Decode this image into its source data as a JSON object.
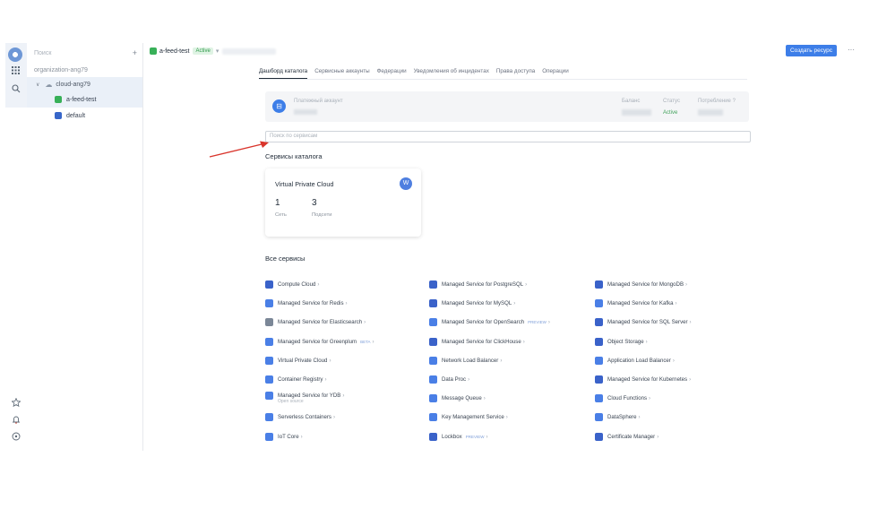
{
  "rail": {
    "icons": [
      "logo-icon",
      "apps-grid-icon",
      "search-icon",
      "star-icon",
      "bell-icon",
      "help-icon"
    ]
  },
  "tree": {
    "search_placeholder": "Поиск",
    "org": "organization-ang79",
    "cloud": "cloud-ang79",
    "folders": [
      {
        "name": "a-feed-test",
        "color": "#38b058"
      },
      {
        "name": "default",
        "color": "#3766c9"
      }
    ]
  },
  "topbar": {
    "folder": "a-feed-test",
    "status": "Active",
    "create_button": "Создать ресурс",
    "more": "···"
  },
  "tabs": [
    "Дашборд каталога",
    "Сервисные аккаунты",
    "Федерации",
    "Уведомления об инцидентах",
    "Права доступа",
    "Операции"
  ],
  "account": {
    "label": "Платежный аккаунт",
    "balance_label": "Баланс",
    "status_label": "Статус",
    "status_value": "Active",
    "consumption_label": "Потребление",
    "consumption_help": "?"
  },
  "service_search": {
    "placeholder": "Поиск по сервисам"
  },
  "catalog_services": {
    "heading": "Сервисы каталога",
    "card": {
      "title": "Virtual Private Cloud",
      "badge": "W",
      "stats": [
        {
          "value": "1",
          "label": "Сеть"
        },
        {
          "value": "3",
          "label": "Подсети"
        }
      ]
    }
  },
  "all_services": {
    "heading": "Все сервисы",
    "columns": [
      [
        {
          "name": "Compute Cloud",
          "icon": "gear-icon",
          "color": "#3a62c9"
        },
        {
          "name": "Managed Service for Redis",
          "icon": "redis-icon",
          "color": "#4a7fe6"
        },
        {
          "name": "Managed Service for Elasticsearch",
          "icon": "elasticsearch-icon",
          "color": "#7b8797"
        },
        {
          "name": "Managed Service for Greenplum",
          "icon": "greenplum-icon",
          "color": "#4a7fe6",
          "tag": "BETA"
        },
        {
          "name": "Virtual Private Cloud",
          "icon": "vpc-icon",
          "color": "#4a7fe6"
        },
        {
          "name": "Container Registry",
          "icon": "container-icon",
          "color": "#4a7fe6"
        },
        {
          "name": "Managed Service for YDB",
          "icon": "ydb-icon",
          "color": "#4a7fe6",
          "sub": "Open source"
        },
        {
          "name": "Serverless Containers",
          "icon": "serverless-icon",
          "color": "#4a7fe6"
        },
        {
          "name": "IoT Core",
          "icon": "iot-icon",
          "color": "#4a7fe6"
        }
      ],
      [
        {
          "name": "Managed Service for PostgreSQL",
          "icon": "postgres-icon",
          "color": "#3a62c9"
        },
        {
          "name": "Managed Service for MySQL",
          "icon": "mysql-icon",
          "color": "#3a62c9"
        },
        {
          "name": "Managed Service for OpenSearch",
          "icon": "opensearch-icon",
          "color": "#4a7fe6",
          "tag": "PREVIEW"
        },
        {
          "name": "Managed Service for ClickHouse",
          "icon": "clickhouse-icon",
          "color": "#3a62c9"
        },
        {
          "name": "Network Load Balancer",
          "icon": "nlb-icon",
          "color": "#4a7fe6"
        },
        {
          "name": "Data Proc",
          "icon": "dataproc-icon",
          "color": "#4a7fe6"
        },
        {
          "name": "Message Queue",
          "icon": "queue-icon",
          "color": "#4a7fe6"
        },
        {
          "name": "Key Management Service",
          "icon": "key-icon",
          "color": "#4a7fe6"
        },
        {
          "name": "Lockbox",
          "icon": "lockbox-icon",
          "color": "#3a62c9",
          "tag": "PREVIEW"
        }
      ],
      [
        {
          "name": "Managed Service for MongoDB",
          "icon": "mongodb-icon",
          "color": "#3a62c9"
        },
        {
          "name": "Managed Service for Kafka",
          "icon": "kafka-icon",
          "color": "#4a7fe6"
        },
        {
          "name": "Managed Service for SQL Server",
          "icon": "sqlserver-icon",
          "color": "#3a62c9"
        },
        {
          "name": "Object Storage",
          "icon": "storage-icon",
          "color": "#3a62c9"
        },
        {
          "name": "Application Load Balancer",
          "icon": "alb-icon",
          "color": "#4a7fe6"
        },
        {
          "name": "Managed Service for Kubernetes",
          "icon": "kubernetes-icon",
          "color": "#3a62c9"
        },
        {
          "name": "Cloud Functions",
          "icon": "functions-icon",
          "color": "#4a7fe6"
        },
        {
          "name": "DataSphere",
          "icon": "datasphere-icon",
          "color": "#4a7fe6"
        },
        {
          "name": "Certificate Manager",
          "icon": "certificate-icon",
          "color": "#3a62c9"
        }
      ]
    ]
  },
  "colors": {
    "accent": "#3d7ee8",
    "active_green": "#38b058",
    "annotation_arrow": "#d9342b"
  }
}
